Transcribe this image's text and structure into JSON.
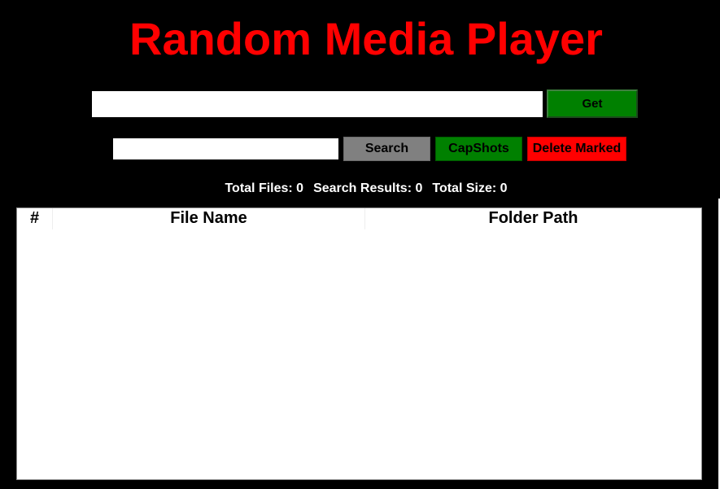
{
  "app": {
    "title": "Random Media Player",
    "colors": {
      "background": "#000000",
      "title": "#ff0000",
      "get_button": "#008000",
      "search_button": "#808080",
      "capshots_button": "#008000",
      "delete_button": "#ff0000"
    }
  },
  "url_bar": {
    "value": "",
    "get_label": "Get"
  },
  "search_bar": {
    "value": "",
    "search_label": "Search",
    "capshots_label": "CapShots",
    "delete_marked_label": "Delete Marked"
  },
  "stats": {
    "total_files": "Total Files: 0",
    "search_results": "Search Results: 0",
    "total_size": "Total Size: 0"
  },
  "table": {
    "columns": [
      "#",
      "File Name",
      "Folder Path"
    ],
    "rows": []
  }
}
